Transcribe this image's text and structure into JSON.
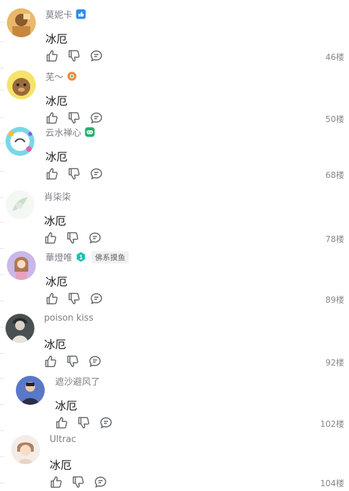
{
  "posts": [
    {
      "user": "莫妮卡",
      "text": "冰厄",
      "floor": "46楼",
      "badge_icon": "thumbs-up-badge-icon"
    },
    {
      "user": "芜～",
      "text": "冰厄",
      "floor": "50楼",
      "badge_icon": "orange-badge-icon"
    },
    {
      "user": "云水禅心",
      "text": "冰厄",
      "floor": "68楼",
      "badge_icon": "green-game-badge-icon"
    },
    {
      "user": "肖柒柒",
      "text": "冰厄",
      "floor": "78楼"
    },
    {
      "user": "華燈唯",
      "text": "冰厄",
      "floor": "89楼",
      "level": "1",
      "tag": "佛系摸鱼"
    },
    {
      "user": "poison kiss",
      "text": "冰厄",
      "floor": "92楼"
    },
    {
      "user": "遮沙避风了",
      "text": "冰厄",
      "floor": "102楼"
    },
    {
      "user": "Ultrac",
      "text": "冰厄",
      "floor": "104楼"
    }
  ],
  "colors": {
    "accent": "#2f8cf0",
    "green": "#21b36b",
    "teal": "#1fbfb0",
    "orange": "#f08a3c",
    "icon_gray": "#62666b"
  }
}
